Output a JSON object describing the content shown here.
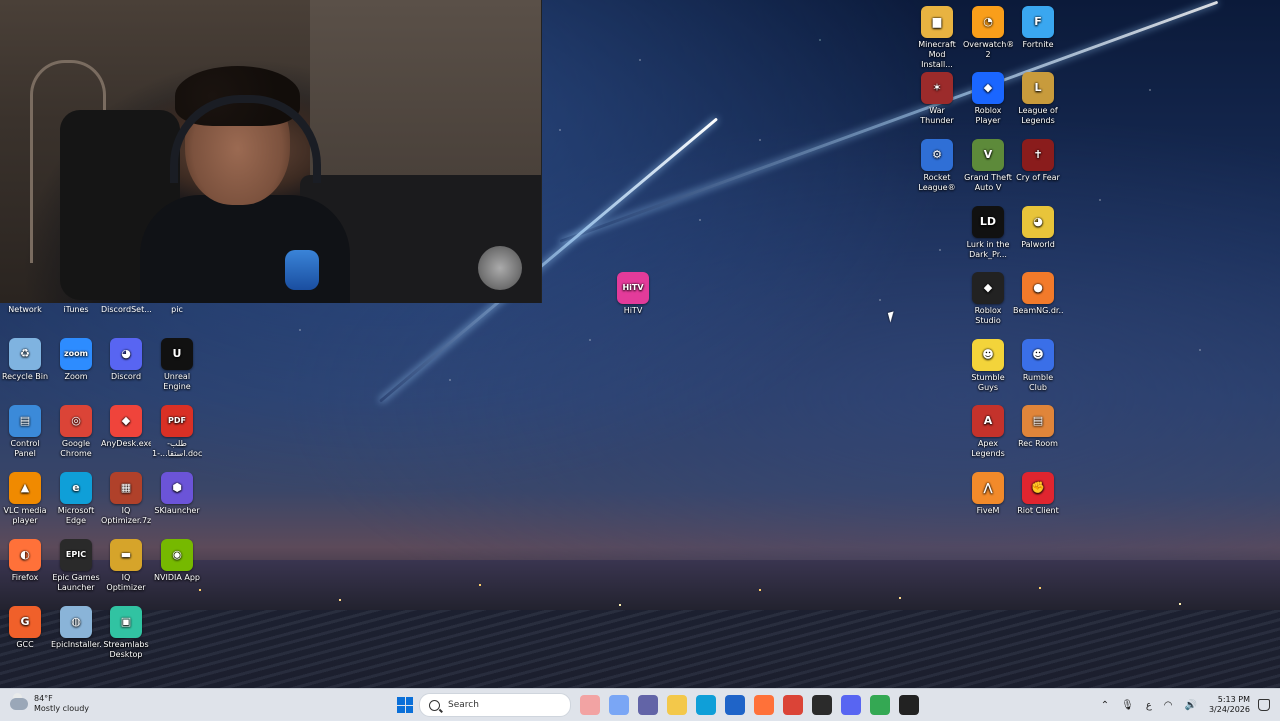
{
  "webcam": {
    "label": ""
  },
  "desktop": {
    "top_strip": [
      {
        "label": "Network"
      },
      {
        "label": "iTunes"
      },
      {
        "label": "DiscordSet..."
      },
      {
        "label": "pic"
      }
    ],
    "left_icons": [
      {
        "label": "Recycle Bin",
        "glyph": "♻",
        "color": "#7fb3e0"
      },
      {
        "label": "Zoom",
        "glyph": "zoom",
        "color": "#2d8cff"
      },
      {
        "label": "Discord",
        "glyph": "◕",
        "color": "#5865f2"
      },
      {
        "label": "Unreal Engine",
        "glyph": "U",
        "color": "#111111"
      },
      {
        "label": "Control Panel",
        "glyph": "▤",
        "color": "#3b8ad9"
      },
      {
        "label": "Google Chrome",
        "glyph": "◎",
        "color": "#db4437"
      },
      {
        "label": "AnyDesk.exe",
        "glyph": "◆",
        "color": "#ef443b"
      },
      {
        "label": "طلب-استقا...-1.docx.pdf",
        "glyph": "PDF",
        "color": "#d93025"
      },
      {
        "label": "VLC media player",
        "glyph": "▲",
        "color": "#f08a00"
      },
      {
        "label": "Microsoft Edge",
        "glyph": "e",
        "color": "#0f9fd8"
      },
      {
        "label": "IQ Optimizer.7z",
        "glyph": "▦",
        "color": "#b0412a"
      },
      {
        "label": "SKlauncher",
        "glyph": "⬢",
        "color": "#6b54d8"
      },
      {
        "label": "Firefox",
        "glyph": "◐",
        "color": "#ff7139"
      },
      {
        "label": "Epic Games Launcher",
        "glyph": "EPIC",
        "color": "#2a2a2a"
      },
      {
        "label": "IQ Optimizer",
        "glyph": "▬",
        "color": "#d6a42a"
      },
      {
        "label": "NVIDIA App",
        "glyph": "◉",
        "color": "#76b900"
      },
      {
        "label": "GCC",
        "glyph": "G",
        "color": "#f0602a"
      },
      {
        "label": "EpicInstaller...",
        "glyph": "◍",
        "color": "#8ab4d8"
      },
      {
        "label": "Streamlabs Desktop",
        "glyph": "▣",
        "color": "#31c3a2"
      }
    ],
    "hitv": {
      "label": "HiTV",
      "glyph": "HiTV",
      "color": "#e33b9a"
    },
    "right_icons": [
      {
        "label": "Minecraft Mod Install...",
        "glyph": "▆",
        "color": "#e8b341"
      },
      {
        "label": "Overwatch® 2",
        "glyph": "◔",
        "color": "#f99e1a"
      },
      {
        "label": "Fortnite",
        "glyph": "F",
        "color": "#3aa7f0"
      },
      {
        "label": "War Thunder",
        "glyph": "✶",
        "color": "#9c2b2b"
      },
      {
        "label": "Roblox Player",
        "glyph": "◆",
        "color": "#1a66ff"
      },
      {
        "label": "League of Legends",
        "glyph": "L",
        "color": "#c89b3c"
      },
      {
        "label": "Rocket League®",
        "glyph": "⚙",
        "color": "#2f6fd6"
      },
      {
        "label": "Grand Theft Auto V",
        "glyph": "V",
        "color": "#5d8a3a"
      },
      {
        "label": "Cry of Fear",
        "glyph": "✝",
        "color": "#8a1c1c"
      },
      {
        "label": "Lurk in the Dark_Pr...",
        "glyph": "LD",
        "color": "#111111"
      },
      {
        "label": "Palworld",
        "glyph": "◕",
        "color": "#e8c43a"
      },
      {
        "label": "Roblox Studio",
        "glyph": "◆",
        "color": "#222222"
      },
      {
        "label": "BeamNG.dr...",
        "glyph": "●",
        "color": "#f27a2a"
      },
      {
        "label": "Stumble Guys",
        "glyph": "☻",
        "color": "#f3d43a"
      },
      {
        "label": "Rumble Club",
        "glyph": "☻",
        "color": "#3a6fe8"
      },
      {
        "label": "Apex Legends",
        "glyph": "A",
        "color": "#c4322b"
      },
      {
        "label": "Rec Room",
        "glyph": "▤",
        "color": "#e0853a"
      },
      {
        "label": "FiveM",
        "glyph": "⋀",
        "color": "#f28a2a"
      },
      {
        "label": "Riot Client",
        "glyph": "✊",
        "color": "#e0252f"
      }
    ]
  },
  "taskbar": {
    "weather_temp": "84°F",
    "weather_desc": "Mostly cloudy",
    "search_placeholder": "Search",
    "apps": [
      {
        "name": "widget-app",
        "color": "#f2a3a3"
      },
      {
        "name": "copilot",
        "color": "#7aa6f5"
      },
      {
        "name": "teams",
        "color": "#6264a7"
      },
      {
        "name": "file-explorer",
        "color": "#f3c84a"
      },
      {
        "name": "edge",
        "color": "#0f9fd8"
      },
      {
        "name": "store",
        "color": "#1f64c8"
      },
      {
        "name": "firefox",
        "color": "#ff7139"
      },
      {
        "name": "chrome",
        "color": "#db4437"
      },
      {
        "name": "obs",
        "color": "#2b2b2b"
      },
      {
        "name": "discord",
        "color": "#5865f2"
      },
      {
        "name": "chrome-profile",
        "color": "#34a853"
      },
      {
        "name": "roblox",
        "color": "#222222"
      }
    ],
    "lang": "ع",
    "time": "5:13 PM",
    "date": "3/24/2026"
  }
}
